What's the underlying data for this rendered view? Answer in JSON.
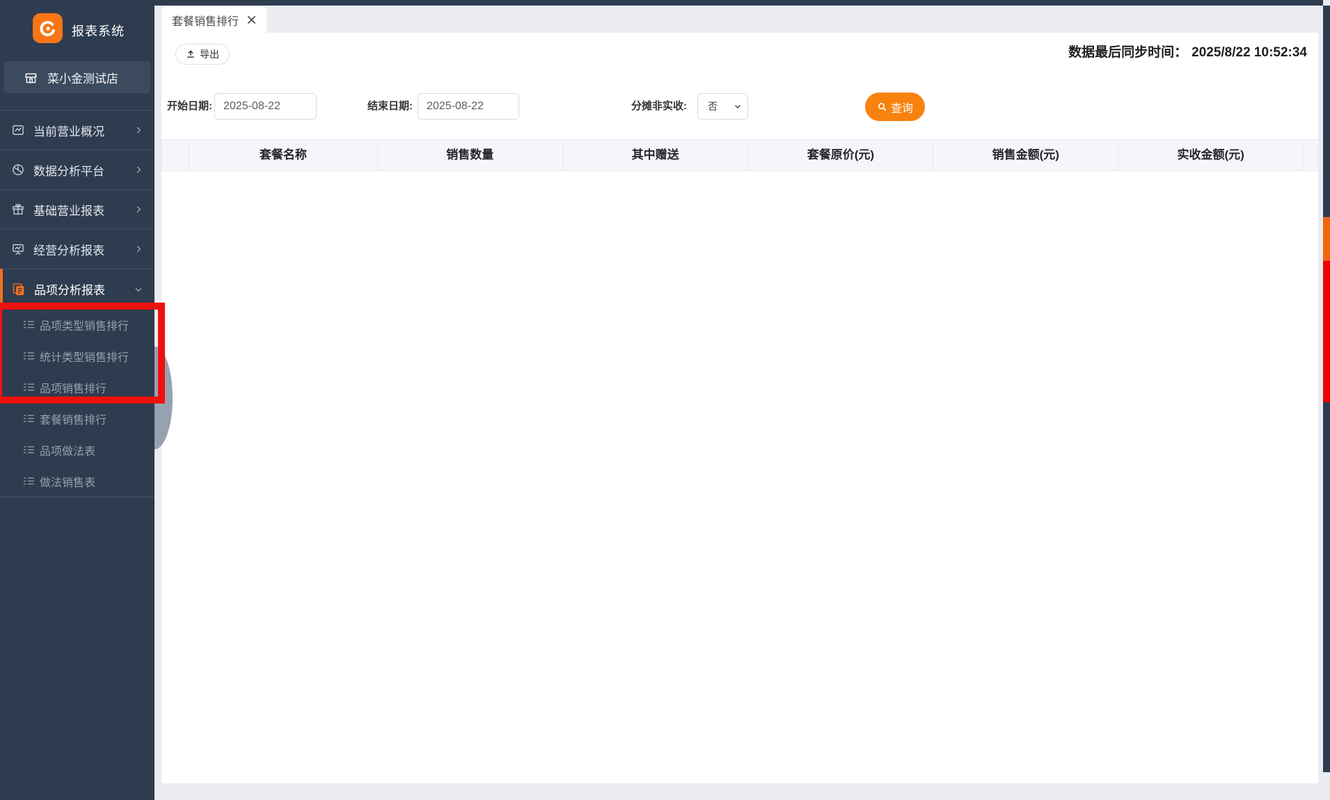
{
  "app": {
    "title": "报表系统",
    "store": "菜小金测试店"
  },
  "sidebar": {
    "items": [
      {
        "label": "当前营业概况",
        "icon": "monitor-chart-icon",
        "chevron": "right",
        "active": false
      },
      {
        "label": "数据分析平台",
        "icon": "data-globe-icon",
        "chevron": "right",
        "active": false
      },
      {
        "label": "基础营业报表",
        "icon": "gift-icon",
        "chevron": "right",
        "active": false
      },
      {
        "label": "经营分析报表",
        "icon": "presentation-icon",
        "chevron": "right",
        "active": false
      },
      {
        "label": "品项分析报表",
        "icon": "documents-icon",
        "chevron": "down",
        "active": true
      }
    ],
    "submenu": [
      {
        "label": "品项类型销售排行"
      },
      {
        "label": "统计类型销售排行"
      },
      {
        "label": "品项销售排行"
      },
      {
        "label": "套餐销售排行"
      },
      {
        "label": "品项做法表"
      },
      {
        "label": "做法销售表"
      }
    ]
  },
  "tabs": {
    "active_label": "套餐销售排行"
  },
  "toolbar": {
    "export_label": "导出",
    "sync_label": "数据最后同步时间：",
    "sync_value": "2025/8/22 10:52:34"
  },
  "filters": {
    "start": {
      "label": "开始日期:",
      "value": "2025-08-22"
    },
    "end": {
      "label": "结束日期:",
      "value": "2025-08-22"
    },
    "apportion": {
      "label": "分摊非实收:",
      "value": "否"
    },
    "query_label": "查询"
  },
  "table": {
    "columns": [
      {
        "label": ""
      },
      {
        "label": "套餐名称"
      },
      {
        "label": "销售数量"
      },
      {
        "label": "其中赠送"
      },
      {
        "label": "套餐原价(元)"
      },
      {
        "label": "销售金额(元)"
      },
      {
        "label": "实收金额(元)"
      },
      {
        "label": ""
      }
    ]
  },
  "annotation": {
    "note": "red highlight box around first three submenu items"
  },
  "colors": {
    "sidebar_bg": "#2e3c50",
    "store_bar_bg": "#3c4a5e",
    "brand_orange": "#f87514",
    "accent_orange": "#f8820f",
    "active_item_orange": "#f2701d",
    "annotation_red": "#f01010",
    "page_bg": "#eaecf1",
    "header_bg": "#f5f6fa"
  }
}
